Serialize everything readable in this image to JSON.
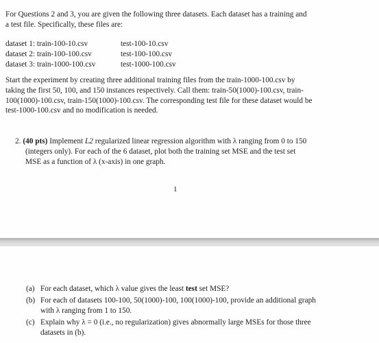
{
  "intro": {
    "line1": "For Questions 2 and 3, you are given the following three datasets. Each dataset has a training and",
    "line2": "a test file. Specifically, these files are:"
  },
  "datasets": [
    {
      "label": "dataset 1:",
      "train": "train-100-10.csv",
      "test": "test-100-10.csv"
    },
    {
      "label": "dataset 2:",
      "train": "train-100-100.csv",
      "test": "test-100-100.csv"
    },
    {
      "label": "dataset 3:",
      "train": "train-1000-100.csv",
      "test": "test-1000-100.csv"
    }
  ],
  "experiment": {
    "line1": "Start the experiment by creating three additional training files from the train-1000-100.csv by",
    "line2": "taking the first 50, 100, and 150 instances respectively. Call them: train-50(1000)-100.csv, train-",
    "line3": "100(1000)-100.csv, train-150(1000)-100.csv. The corresponding test file for these dataset would be",
    "line4": "test-1000-100.csv and no modification is needed."
  },
  "question2": {
    "number": "2.",
    "points": "(40 pts)",
    "line1_a": " Implement ",
    "line1_l2": "L2",
    "line1_b": " regularized linear regression algorithm with λ ranging from 0 to 150",
    "line2": "(integers only). For each of the 6 dataset, plot both the training set MSE and the test set",
    "line3": "MSE as a function of λ (x-axis) in one graph."
  },
  "page_number": "1",
  "subquestions": [
    {
      "label": "(a)",
      "text_a": "For each dataset, which λ value gives the least ",
      "bold": "test",
      "text_b": " set MSE?"
    },
    {
      "label": "(b)",
      "line1": "For each of datasets 100-100, 50(1000)-100, 100(1000)-100, provide an additional graph",
      "line2": "with λ ranging from 1 to 150."
    },
    {
      "label": "(c)",
      "line1": "Explain why λ = 0 (i.e., no regularization) gives abnormally large MSEs for those three",
      "line2": "datasets in (b)."
    }
  ]
}
